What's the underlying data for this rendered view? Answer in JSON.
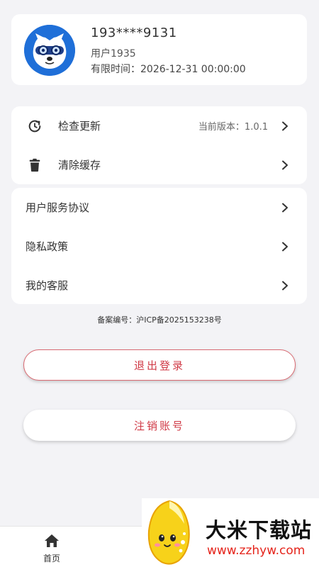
{
  "profile": {
    "phone": "193****9131",
    "username": "用户1935",
    "expire": "有限时间：2026-12-31 00:00:00"
  },
  "settings": {
    "check_update": {
      "label": "检查更新",
      "value": "当前版本：1.0.1"
    },
    "clear_cache": {
      "label": "清除缓存"
    }
  },
  "links": {
    "user_agreement": "用户服务协议",
    "privacy_policy": "隐私政策",
    "customer_service": "我的客服"
  },
  "icp": "备案编号：沪ICP备2025153238号",
  "buttons": {
    "logout": "退出登录",
    "cancel_account": "注销账号"
  },
  "tabbar": {
    "home": "首页"
  },
  "watermark": {
    "title": "大米下载站",
    "url": "www.zzhyw.com"
  },
  "colors": {
    "accent_red": "#d03a46",
    "avatar_blue": "#1f6fd8",
    "background": "#f3f3f6"
  }
}
